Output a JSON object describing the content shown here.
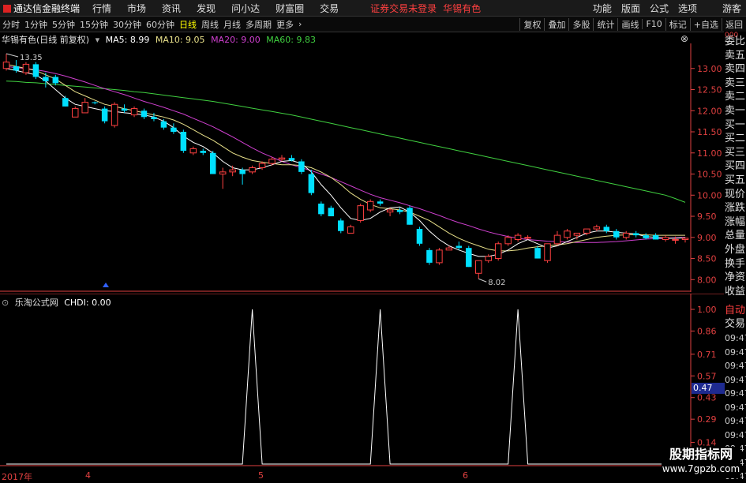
{
  "app": {
    "title": "通达信金融终端",
    "menu": [
      "行情",
      "市场",
      "资讯",
      "发现",
      "问小达",
      "财富圈",
      "交易"
    ],
    "notice": "证券交易未登录",
    "stock": "华锡有色",
    "right_menu": [
      "功能",
      "版面",
      "公式",
      "选项"
    ],
    "user": "游客"
  },
  "toolbar": {
    "periods": [
      "分时",
      "1分钟",
      "5分钟",
      "15分钟",
      "30分钟",
      "60分钟",
      "日线",
      "周线",
      "月线",
      "多周期",
      "更多"
    ],
    "active": "日线",
    "right": [
      "复权",
      "叠加",
      "多股",
      "统计",
      "画线",
      "F10",
      "标记",
      "+自选",
      "返回"
    ]
  },
  "main_legend": {
    "title": "华锡有色(日线 前复权)",
    "ma5": "MA5: 8.99",
    "ma10": "MA10: 9.05",
    "ma20": "MA20: 9.00",
    "ma60": "MA60: 9.83"
  },
  "sub_legend": {
    "title": "乐淘公式网",
    "value": "CHDI: 0.00"
  },
  "annotations": {
    "high": "13.35",
    "low": "8.02"
  },
  "right_panel": {
    "items": [
      "委比",
      "卖五",
      "卖四",
      "卖三",
      "卖二",
      "卖一",
      "买一",
      "买二",
      "买三",
      "买四",
      "买五",
      "现价",
      "涨跌",
      "涨幅",
      "总量",
      "外盘",
      "换手",
      "净资",
      "收益"
    ],
    "auto": "自动",
    "trade": "交易",
    "times": [
      "09:47",
      "09:47",
      "09:47",
      "09:47",
      "09:47",
      "09:47",
      "09:47",
      "09:47",
      "09:47",
      "09:47",
      "09:47"
    ],
    "top_label": "000"
  },
  "price_tag": "0.47",
  "dates": {
    "year": "2017年",
    "m4": "4",
    "m5": "5",
    "m6": "6"
  },
  "watermark": {
    "line1": "股期指标网",
    "line2": "www.7gpzb.com"
  },
  "colors": {
    "up": "#ff4040",
    "down": "#00e0ff",
    "ma5": "#ffffff",
    "ma10": "#e8e08a",
    "ma20": "#d040d0",
    "ma60": "#40d040",
    "axis": "#e04040",
    "indicator": "#ffffff"
  },
  "chart_data": [
    {
      "type": "candlestick",
      "title": "",
      "ylim": [
        7.8,
        13.5
      ],
      "yticks": [
        8.0,
        8.5,
        9.0,
        9.5,
        10.0,
        10.5,
        11.0,
        11.5,
        12.0,
        12.5,
        13.0
      ],
      "candles": [
        {
          "o": 13.0,
          "h": 13.35,
          "l": 12.95,
          "c": 13.15
        },
        {
          "o": 13.05,
          "h": 13.2,
          "l": 12.9,
          "c": 12.95
        },
        {
          "o": 12.9,
          "h": 13.15,
          "l": 12.85,
          "c": 13.1
        },
        {
          "o": 13.1,
          "h": 13.15,
          "l": 12.75,
          "c": 12.8
        },
        {
          "o": 12.8,
          "h": 12.9,
          "l": 12.55,
          "c": 12.7
        },
        {
          "o": 12.8,
          "h": 12.85,
          "l": 12.6,
          "c": 12.65
        },
        {
          "o": 12.3,
          "h": 12.35,
          "l": 12.1,
          "c": 12.1
        },
        {
          "o": 11.85,
          "h": 12.1,
          "l": 11.85,
          "c": 12.05
        },
        {
          "o": 11.95,
          "h": 12.3,
          "l": 11.95,
          "c": 12.2
        },
        {
          "o": 12.2,
          "h": 12.22,
          "l": 12.15,
          "c": 12.18
        },
        {
          "o": 12.05,
          "h": 12.1,
          "l": 11.7,
          "c": 11.75
        },
        {
          "o": 11.65,
          "h": 12.2,
          "l": 11.6,
          "c": 12.15
        },
        {
          "o": 12.05,
          "h": 12.15,
          "l": 11.95,
          "c": 12.0
        },
        {
          "o": 11.9,
          "h": 12.1,
          "l": 11.85,
          "c": 12.05
        },
        {
          "o": 12.0,
          "h": 12.05,
          "l": 11.8,
          "c": 11.85
        },
        {
          "o": 11.85,
          "h": 11.95,
          "l": 11.75,
          "c": 11.8
        },
        {
          "o": 11.75,
          "h": 11.8,
          "l": 11.55,
          "c": 11.6
        },
        {
          "o": 11.6,
          "h": 11.7,
          "l": 11.45,
          "c": 11.5
        },
        {
          "o": 11.5,
          "h": 11.55,
          "l": 11.0,
          "c": 11.05
        },
        {
          "o": 11.0,
          "h": 11.15,
          "l": 10.95,
          "c": 11.1
        },
        {
          "o": 11.05,
          "h": 11.1,
          "l": 10.95,
          "c": 11.0
        },
        {
          "o": 11.0,
          "h": 11.05,
          "l": 10.5,
          "c": 10.5
        },
        {
          "o": 10.5,
          "h": 10.65,
          "l": 10.15,
          "c": 10.55
        },
        {
          "o": 10.55,
          "h": 10.7,
          "l": 10.45,
          "c": 10.6
        },
        {
          "o": 10.6,
          "h": 10.65,
          "l": 10.25,
          "c": 10.5
        },
        {
          "o": 10.55,
          "h": 10.7,
          "l": 10.5,
          "c": 10.65
        },
        {
          "o": 10.65,
          "h": 10.8,
          "l": 10.6,
          "c": 10.75
        },
        {
          "o": 10.75,
          "h": 10.9,
          "l": 10.7,
          "c": 10.85
        },
        {
          "o": 10.85,
          "h": 10.95,
          "l": 10.8,
          "c": 10.88
        },
        {
          "o": 10.88,
          "h": 10.95,
          "l": 10.8,
          "c": 10.82
        },
        {
          "o": 10.8,
          "h": 10.85,
          "l": 10.5,
          "c": 10.55
        },
        {
          "o": 10.5,
          "h": 10.6,
          "l": 10.0,
          "c": 10.05
        },
        {
          "o": 9.8,
          "h": 9.85,
          "l": 9.5,
          "c": 9.55
        },
        {
          "o": 9.7,
          "h": 9.75,
          "l": 9.5,
          "c": 9.5
        },
        {
          "o": 9.4,
          "h": 9.45,
          "l": 9.1,
          "c": 9.15
        },
        {
          "o": 9.1,
          "h": 9.3,
          "l": 9.1,
          "c": 9.25
        },
        {
          "o": 9.4,
          "h": 9.8,
          "l": 9.35,
          "c": 9.75
        },
        {
          "o": 9.65,
          "h": 9.9,
          "l": 9.6,
          "c": 9.85
        },
        {
          "o": 9.85,
          "h": 9.9,
          "l": 9.75,
          "c": 9.8
        },
        {
          "o": 9.6,
          "h": 9.7,
          "l": 9.5,
          "c": 9.65
        },
        {
          "o": 9.65,
          "h": 9.7,
          "l": 9.55,
          "c": 9.6
        },
        {
          "o": 9.7,
          "h": 9.75,
          "l": 9.3,
          "c": 9.3
        },
        {
          "o": 9.2,
          "h": 9.25,
          "l": 8.8,
          "c": 8.85
        },
        {
          "o": 8.7,
          "h": 8.75,
          "l": 8.35,
          "c": 8.4
        },
        {
          "o": 8.4,
          "h": 8.75,
          "l": 8.35,
          "c": 8.7
        },
        {
          "o": 8.7,
          "h": 8.8,
          "l": 8.7,
          "c": 8.75
        },
        {
          "o": 8.8,
          "h": 8.9,
          "l": 8.7,
          "c": 8.75
        },
        {
          "o": 8.75,
          "h": 8.8,
          "l": 8.3,
          "c": 8.3
        },
        {
          "o": 8.15,
          "h": 8.45,
          "l": 8.02,
          "c": 8.45
        },
        {
          "o": 8.45,
          "h": 8.6,
          "l": 8.4,
          "c": 8.55
        },
        {
          "o": 8.5,
          "h": 8.9,
          "l": 8.45,
          "c": 8.85
        },
        {
          "o": 8.85,
          "h": 9.05,
          "l": 8.8,
          "c": 9.0
        },
        {
          "o": 8.95,
          "h": 9.1,
          "l": 8.9,
          "c": 9.05
        },
        {
          "o": 9.0,
          "h": 9.05,
          "l": 8.95,
          "c": 9.0
        },
        {
          "o": 8.75,
          "h": 8.8,
          "l": 8.5,
          "c": 8.5
        },
        {
          "o": 8.45,
          "h": 8.85,
          "l": 8.4,
          "c": 8.85
        },
        {
          "o": 8.85,
          "h": 9.15,
          "l": 8.8,
          "c": 9.05
        },
        {
          "o": 9.0,
          "h": 9.2,
          "l": 8.95,
          "c": 9.15
        },
        {
          "o": 9.05,
          "h": 9.1,
          "l": 8.95,
          "c": 9.1
        },
        {
          "o": 9.1,
          "h": 9.2,
          "l": 9.05,
          "c": 9.2
        },
        {
          "o": 9.2,
          "h": 9.3,
          "l": 9.15,
          "c": 9.25
        },
        {
          "o": 9.25,
          "h": 9.3,
          "l": 9.1,
          "c": 9.15
        },
        {
          "o": 9.15,
          "h": 9.2,
          "l": 8.95,
          "c": 9.0
        },
        {
          "o": 9.0,
          "h": 9.15,
          "l": 8.95,
          "c": 9.1
        },
        {
          "o": 9.1,
          "h": 9.15,
          "l": 9.0,
          "c": 9.05
        },
        {
          "o": 9.05,
          "h": 9.1,
          "l": 8.95,
          "c": 8.98
        },
        {
          "o": 9.05,
          "h": 9.1,
          "l": 8.95,
          "c": 8.95
        },
        {
          "o": 8.95,
          "h": 9.05,
          "l": 8.9,
          "c": 9.0
        },
        {
          "o": 8.95,
          "h": 9.02,
          "l": 8.85,
          "c": 8.95
        },
        {
          "o": 8.95,
          "h": 9.0,
          "l": 8.88,
          "c": 8.98
        }
      ],
      "ma5": [
        13.0,
        12.95,
        12.9,
        12.85,
        12.7,
        12.5,
        12.3,
        12.15,
        12.1,
        12.05,
        12.0,
        11.98,
        11.95,
        11.93,
        11.9,
        11.85,
        11.75,
        11.6,
        11.4,
        11.25,
        11.15,
        11.0,
        10.8,
        10.65,
        10.6,
        10.6,
        10.65,
        10.72,
        10.8,
        10.82,
        10.75,
        10.55,
        10.25,
        10.0,
        9.7,
        9.45,
        9.4,
        9.45,
        9.6,
        9.7,
        9.72,
        9.6,
        9.4,
        9.15,
        8.95,
        8.8,
        8.7,
        8.62,
        8.55,
        8.55,
        8.6,
        8.7,
        8.85,
        8.95,
        8.85,
        8.75,
        8.8,
        8.9,
        9.0,
        9.1,
        9.15,
        9.15,
        9.12,
        9.1,
        9.08,
        9.02,
        9.0,
        8.98,
        8.98,
        8.99
      ],
      "ma10": [
        13.1,
        13.05,
        13.0,
        12.95,
        12.85,
        12.75,
        12.6,
        12.45,
        12.35,
        12.25,
        12.15,
        12.1,
        12.05,
        12.0,
        11.95,
        11.9,
        11.85,
        11.78,
        11.68,
        11.55,
        11.42,
        11.3,
        11.15,
        11.0,
        10.9,
        10.82,
        10.78,
        10.75,
        10.72,
        10.72,
        10.7,
        10.65,
        10.55,
        10.42,
        10.25,
        10.05,
        9.9,
        9.78,
        9.7,
        9.68,
        9.65,
        9.6,
        9.5,
        9.4,
        9.25,
        9.1,
        8.98,
        8.88,
        8.8,
        8.72,
        8.68,
        8.68,
        8.7,
        8.75,
        8.78,
        8.8,
        8.82,
        8.85,
        8.9,
        8.95,
        9.0,
        9.03,
        9.05,
        9.06,
        9.07,
        9.06,
        9.05,
        9.05,
        9.05,
        9.05
      ],
      "ma20": [
        13.05,
        13.02,
        13.0,
        12.97,
        12.93,
        12.88,
        12.82,
        12.75,
        12.68,
        12.6,
        12.52,
        12.45,
        12.38,
        12.3,
        12.22,
        12.15,
        12.08,
        12.0,
        11.92,
        11.82,
        11.72,
        11.62,
        11.5,
        11.38,
        11.25,
        11.12,
        11.0,
        10.9,
        10.8,
        10.72,
        10.65,
        10.58,
        10.5,
        10.42,
        10.32,
        10.22,
        10.12,
        10.02,
        9.94,
        9.88,
        9.82,
        9.75,
        9.68,
        9.6,
        9.52,
        9.43,
        9.35,
        9.28,
        9.2,
        9.13,
        9.07,
        9.02,
        8.98,
        8.95,
        8.93,
        8.91,
        8.9,
        8.89,
        8.88,
        8.88,
        8.88,
        8.89,
        8.9,
        8.92,
        8.94,
        8.96,
        8.97,
        8.98,
        8.99,
        9.0
      ],
      "ma60": [
        12.7,
        12.69,
        12.67,
        12.66,
        12.64,
        12.62,
        12.6,
        12.58,
        12.56,
        12.54,
        12.52,
        12.5,
        12.48,
        12.45,
        12.43,
        12.4,
        12.37,
        12.34,
        12.31,
        12.28,
        12.25,
        12.22,
        12.18,
        12.14,
        12.1,
        12.06,
        12.02,
        11.98,
        11.94,
        11.9,
        11.85,
        11.8,
        11.75,
        11.7,
        11.65,
        11.6,
        11.55,
        11.5,
        11.45,
        11.4,
        11.35,
        11.3,
        11.25,
        11.2,
        11.15,
        11.1,
        11.05,
        11.0,
        10.95,
        10.9,
        10.85,
        10.8,
        10.75,
        10.7,
        10.65,
        10.6,
        10.55,
        10.5,
        10.45,
        10.4,
        10.35,
        10.3,
        10.25,
        10.2,
        10.15,
        10.1,
        10.05,
        10.0,
        9.92,
        9.83
      ]
    },
    {
      "type": "line",
      "title": "",
      "ylim": [
        0,
        1.0
      ],
      "yticks": [
        0.0,
        0.14,
        0.29,
        0.43,
        0.57,
        0.71,
        0.86,
        1.0
      ],
      "ytick_labels": [
        "0.00",
        "0.14",
        "0.29",
        "0.43",
        "0.57",
        "0.71",
        "0.86",
        "1.00"
      ],
      "values": [
        0,
        0,
        0,
        0,
        0,
        0,
        0,
        0,
        0,
        0,
        0,
        0,
        0,
        0,
        0,
        0,
        0,
        0,
        0,
        0,
        0,
        0,
        0,
        0,
        0,
        0,
        0,
        0,
        0,
        0,
        0,
        0,
        0,
        0,
        0,
        0,
        0,
        0,
        0,
        0,
        0,
        0,
        0,
        0,
        0,
        0,
        0,
        0,
        0,
        0,
        0,
        0,
        0,
        0,
        0,
        0,
        0,
        0,
        0,
        0,
        0,
        0,
        0,
        0,
        0,
        0,
        0,
        0,
        0,
        0
      ],
      "peaks": [
        25,
        38,
        52
      ]
    }
  ]
}
